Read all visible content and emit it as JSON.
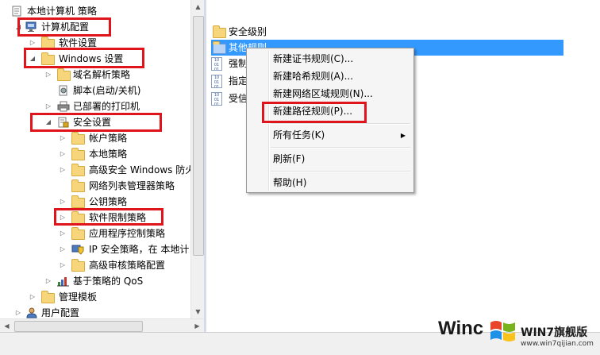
{
  "tree": {
    "root": "本地计算机 策略",
    "computer_config": "计算机配置",
    "software_settings": "软件设置",
    "windows_settings": "Windows 设置",
    "dns_policy": "域名解析策略",
    "scripts": "脚本(启动/关机)",
    "printers": "已部署的打印机",
    "security_settings": "安全设置",
    "account_policies": "帐户策略",
    "local_policies": "本地策略",
    "firewall": "高级安全 Windows 防火",
    "network_list": "网络列表管理器策略",
    "public_key": "公钥策略",
    "software_restriction": "软件限制策略",
    "app_control": "应用程序控制策略",
    "ipsec": "IP 安全策略，在 本地计",
    "audit": "高级审核策略配置",
    "qos": "基于策略的 QoS",
    "admin_templates": "管理模板",
    "user_config": "用户配置"
  },
  "right": {
    "security_levels": "安全级别",
    "other_rules": "其他规则",
    "enforce": "强制",
    "designated": "指定",
    "trusted": "受信"
  },
  "context_menu": {
    "new_cert_rule": "新建证书规则(C)...",
    "new_hash_rule": "新建哈希规则(A)...",
    "new_zone_rule": "新建网络区域规则(N)...",
    "new_path_rule": "新建路径规则(P)...",
    "all_tasks": "所有任务(K)",
    "refresh": "刷新(F)",
    "help": "帮助(H)"
  },
  "watermark": {
    "left_text": "Winc",
    "brand": "WIN7旗舰版",
    "url": "www.win7qijian.com"
  },
  "colors": {
    "highlight_box": "#e0141b",
    "selection": "#3399ff"
  }
}
